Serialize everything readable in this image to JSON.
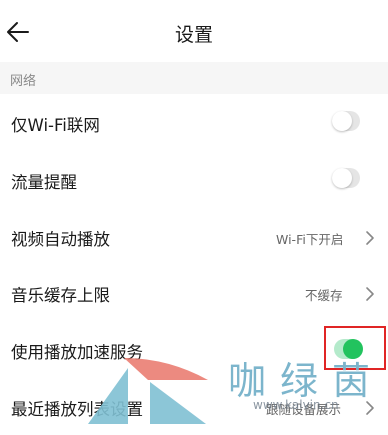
{
  "header": {
    "title": "设置"
  },
  "section": {
    "title": "网络"
  },
  "rows": [
    {
      "label": "仅Wi-Fi联网",
      "toggle": false
    },
    {
      "label": "流量提醒",
      "toggle": false
    },
    {
      "label": "视频自动播放",
      "value": "Wi-Fi下开启"
    },
    {
      "label": "音乐缓存上限",
      "value": "不缓存"
    },
    {
      "label": "使用播放加速服务",
      "toggle": true
    },
    {
      "label": "最近播放列表设置",
      "value": "跟随设备展示"
    }
  ],
  "watermark": {
    "text": "咖绿茵",
    "url": "www.kalvin.cn"
  },
  "colors": {
    "toggle_on": "#22c35e",
    "toggle_on_track": "#b4eacb",
    "toggle_off_track": "#e5e5e5",
    "highlight": "#e02525",
    "section_bg": "#f6f6f6"
  }
}
